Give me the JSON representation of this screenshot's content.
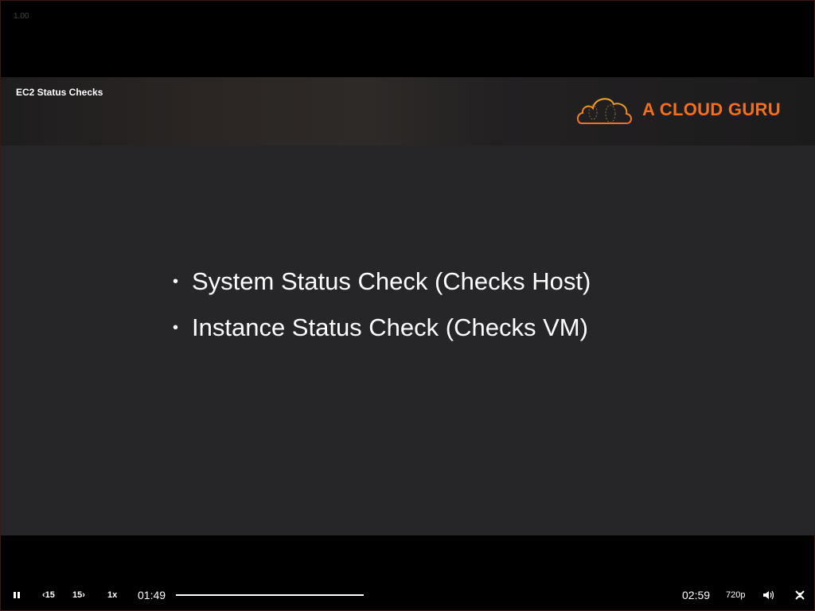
{
  "overlay_rate": "1.00",
  "slide": {
    "title": "EC2 Status Checks",
    "logo_text": "A CLOUD GURU",
    "bullets": [
      "System Status Check (Checks Host)",
      "Instance Status Check (Checks VM)"
    ],
    "accent_color": "#f36f21"
  },
  "player": {
    "pause_icon": "pause-icon",
    "rewind_label": "‹15",
    "forward_label": "15›",
    "speed_label": "1x",
    "current_time": "01:49",
    "progress": 0.38,
    "remaining_time": "02:59",
    "quality_label": "720p",
    "volume_icon": "volume-icon",
    "exit_fullscreen_icon": "exit-fullscreen-icon"
  }
}
